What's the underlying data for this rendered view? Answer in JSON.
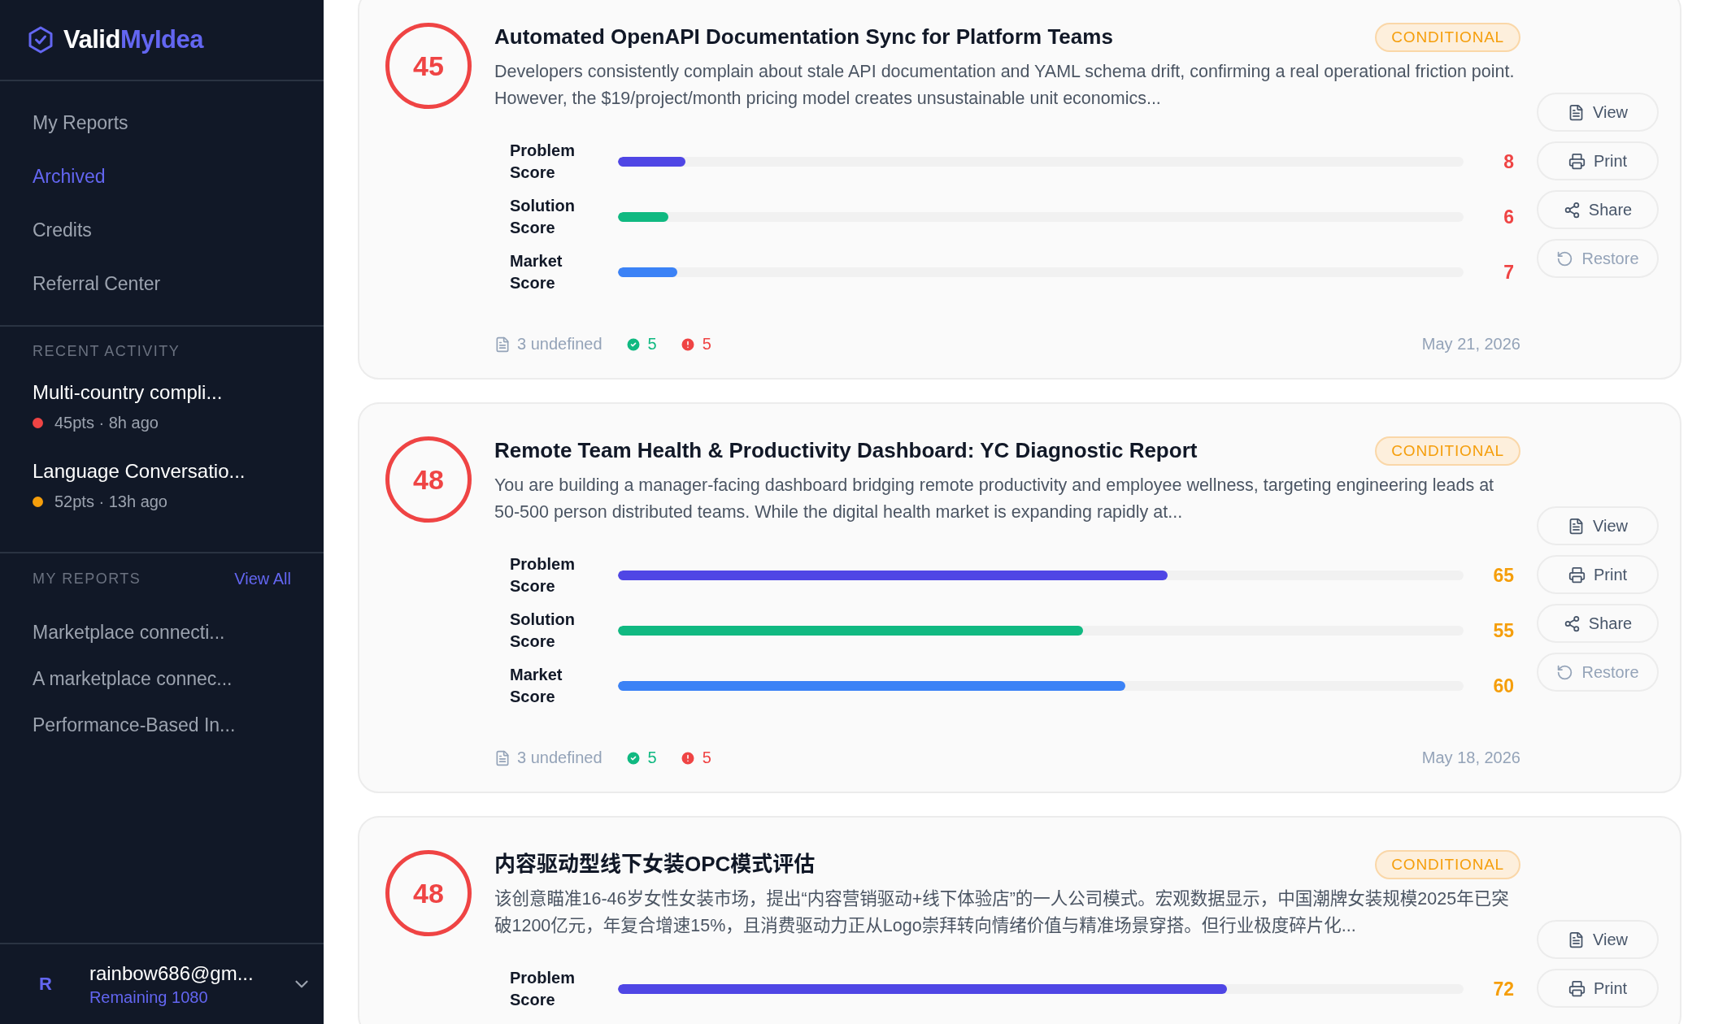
{
  "sidebar": {
    "logo": {
      "first": "Valid",
      "second": "MyIdea"
    },
    "nav": [
      {
        "label": "My Reports",
        "selected": false
      },
      {
        "label": "Archived",
        "selected": true
      },
      {
        "label": "Credits",
        "selected": false
      },
      {
        "label": "Referral Center",
        "selected": false
      }
    ],
    "recent_activity": {
      "heading": "RECENT ACTIVITY",
      "items": [
        {
          "title": "Multi-country compli...",
          "meta": "45pts · 8h ago",
          "color": "#ef4444"
        },
        {
          "title": "Language Conversatio...",
          "meta": "52pts · 13h ago",
          "color": "#f59e0b"
        }
      ]
    },
    "my_reports": {
      "heading": "MY REPORTS",
      "link": "View All",
      "items": [
        "Marketplace connecti...",
        "A marketplace connec...",
        "Performance-Based In..."
      ]
    },
    "user": {
      "initial": "R",
      "email": "rainbow686@gm...",
      "remaining": "Remaining 1080"
    }
  },
  "reports": [
    {
      "score": "45",
      "title": "Automated OpenAPI Documentation Sync for Platform Teams",
      "badge": "CONDITIONAL",
      "description": "Developers consistently complain about stale API documentation and YAML schema drift, confirming a real operational friction point. However, the $19/project/month pricing model creates unsustainable unit economics...",
      "metrics": [
        {
          "kind": "problem",
          "label": "Problem Score",
          "level": 0.08,
          "value": "8",
          "color": "#ef4444"
        },
        {
          "kind": "solution",
          "label": "Solution Score",
          "level": 0.06,
          "value": "6",
          "color": "#ef4444"
        },
        {
          "kind": "market",
          "label": "Market Score",
          "level": 0.07,
          "value": "7",
          "color": "#ef4444"
        }
      ],
      "footer": {
        "docs": "3 undefined",
        "passed": "5",
        "issues": "5",
        "date": "May 21, 2026"
      },
      "actions": [
        {
          "kind": "view",
          "label": "View",
          "disabled": false
        },
        {
          "kind": "print",
          "label": "Print",
          "disabled": false
        },
        {
          "kind": "share",
          "label": "Share",
          "disabled": false
        },
        {
          "kind": "restore",
          "label": "Restore",
          "disabled": true
        }
      ]
    },
    {
      "score": "48",
      "title": "Remote Team Health & Productivity Dashboard: YC Diagnostic Report",
      "badge": "CONDITIONAL",
      "description": "You are building a manager-facing dashboard bridging remote productivity and employee wellness, targeting engineering leads at 50-500 person distributed teams. While the digital health market is expanding rapidly at...",
      "metrics": [
        {
          "kind": "problem",
          "label": "Problem Score",
          "level": 0.65,
          "value": "65",
          "color": "#f59e0b"
        },
        {
          "kind": "solution",
          "label": "Solution Score",
          "level": 0.55,
          "value": "55",
          "color": "#f59e0b"
        },
        {
          "kind": "market",
          "label": "Market Score",
          "level": 0.6,
          "value": "60",
          "color": "#f59e0b"
        }
      ],
      "footer": {
        "docs": "3 undefined",
        "passed": "5",
        "issues": "5",
        "date": "May 18, 2026"
      },
      "actions": [
        {
          "kind": "view",
          "label": "View",
          "disabled": false
        },
        {
          "kind": "print",
          "label": "Print",
          "disabled": false
        },
        {
          "kind": "share",
          "label": "Share",
          "disabled": false
        },
        {
          "kind": "restore",
          "label": "Restore",
          "disabled": true
        }
      ]
    },
    {
      "score": "48",
      "title": "内容驱动型线下女装OPC模式评估",
      "badge": "CONDITIONAL",
      "description": "该创意瞄准16-46岁女性女装市场，提出“内容营销驱动+线下体验店”的一人公司模式。宏观数据显示，中国潮牌女装规模2025年已突破1200亿元，年复合增速15%，且消费驱动力正从Logo崇拜转向情绪价值与精准场景穿搭。但行业极度碎片化...",
      "metrics": [
        {
          "kind": "problem",
          "label": "Problem Score",
          "level": 0.72,
          "value": "72",
          "color": "#f59e0b"
        }
      ],
      "actions": [
        {
          "kind": "view",
          "label": "View",
          "disabled": false
        },
        {
          "kind": "print",
          "label": "Print",
          "disabled": false
        }
      ]
    }
  ]
}
